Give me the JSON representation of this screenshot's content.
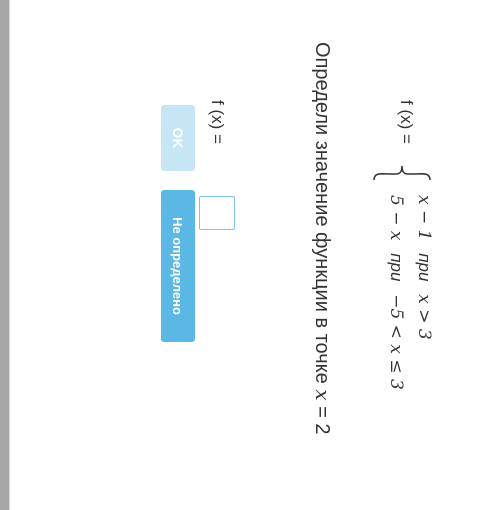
{
  "question": {
    "prefix": "Определи значение функции в точке",
    "variable": "x",
    "equals_value": " = 2"
  },
  "function": {
    "name_label": "f (x) =",
    "pieces": [
      {
        "expression": "x − 1",
        "condition_word": "при",
        "condition": "x > 3"
      },
      {
        "expression": "5 − x",
        "condition_word": "при",
        "condition": "−5 < x ≤ 3"
      }
    ]
  },
  "answer": {
    "label": "f (x) =",
    "value": "",
    "placeholder": ""
  },
  "buttons": {
    "ok_label": "OK",
    "undefined_label": "Не определено"
  },
  "colors": {
    "ok_button_bg": "#c6e6f6",
    "undefined_button_bg": "#5bb7e3",
    "input_border": "#7fc4e8",
    "text": "#333333"
  }
}
